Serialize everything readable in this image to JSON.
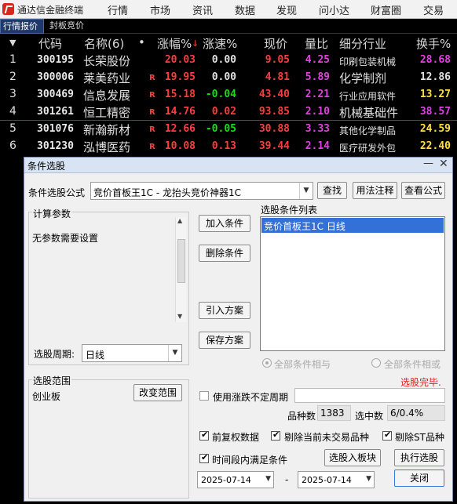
{
  "app": {
    "title": "通达信金融终端",
    "menu": [
      "行情",
      "市场",
      "资讯",
      "数据",
      "发现",
      "问小达",
      "财富圈",
      "交易"
    ]
  },
  "tabs": [
    "行情报价",
    "封板竞价"
  ],
  "table": {
    "headers": {
      "index": "▼",
      "code": "代码",
      "name": "名称(6)",
      "dot": "•",
      "pct": "涨幅%",
      "speed": "涨速%",
      "price": "现价",
      "vol_ratio": "量比",
      "industry": "细分行业",
      "turnover": "换手%"
    },
    "rows": [
      {
        "idx": "1",
        "code": "300195",
        "name": "长荣股份",
        "flag": "",
        "pct": "20.03",
        "speed": "0.00",
        "price": "9.05",
        "vr": "4.25",
        "ind": "印刷包装机械",
        "to": "28.68"
      },
      {
        "idx": "2",
        "code": "300006",
        "name": "莱美药业",
        "flag": "R",
        "pct": "19.95",
        "speed": "0.00",
        "price": "4.81",
        "vr": "5.89",
        "ind": "化学制剂",
        "to": "12.86"
      },
      {
        "idx": "3",
        "code": "300469",
        "name": "信息发展",
        "flag": "R",
        "pct": "15.18",
        "speed": "-0.04",
        "price": "43.40",
        "vr": "2.21",
        "ind": "行业应用软件",
        "to": "13.27"
      },
      {
        "idx": "4",
        "code": "301261",
        "name": "恒工精密",
        "flag": "R",
        "pct": "14.76",
        "speed": "0.02",
        "price": "93.85",
        "vr": "2.10",
        "ind": "机械基础件",
        "to": "38.57"
      },
      {
        "idx": "5",
        "code": "301076",
        "name": "新瀚新材",
        "flag": "R",
        "pct": "12.66",
        "speed": "-0.05",
        "price": "30.88",
        "vr": "3.33",
        "ind": "其他化学制品",
        "to": "24.59"
      },
      {
        "idx": "6",
        "code": "301230",
        "name": "泓博医药",
        "flag": "R",
        "pct": "10.08",
        "speed": "0.13",
        "price": "39.44",
        "vr": "2.14",
        "ind": "医疗研发外包",
        "to": "22.40"
      }
    ]
  },
  "dialog": {
    "title": "条件选股",
    "formula_label": "条件选股公式",
    "formula_value": "竞价首板王1C  -  龙抬头竞价神器1C",
    "btn_find": "查找",
    "btn_usage": "用法注释",
    "btn_view": "查看公式",
    "params_group": "计算参数",
    "params_text": "无参数需要设置",
    "period_label": "选股周期:",
    "period_value": "日线",
    "btn_add": "加入条件",
    "btn_del": "删除条件",
    "btn_import": "引入方案",
    "btn_save": "保存方案",
    "cond_list_label": "选股条件列表",
    "cond_items": [
      "竞价首板王1C  日线"
    ],
    "radio_and": "全部条件相与",
    "radio_or": "全部条件相或",
    "status": "选股完毕.",
    "range_group": "选股范围",
    "range_value": "创业板",
    "btn_change_range": "改变范围",
    "chk_period": "使用涨跌不定周期",
    "count_label": "品种数",
    "count_value": "1383",
    "hit_label": "选中数",
    "hit_value": "6/0.4%",
    "chk_prefq": "前复权数据",
    "chk_exclude_halt": "剔除当前未交易品种",
    "chk_exclude_st": "剔除ST品种",
    "chk_range": "时间段内满足条件",
    "btn_to_block": "选股入板块",
    "btn_run": "执行选股",
    "btn_close": "关闭",
    "date_from": "2025-07-14",
    "date_to": "2025-07-14",
    "dash": "-"
  }
}
